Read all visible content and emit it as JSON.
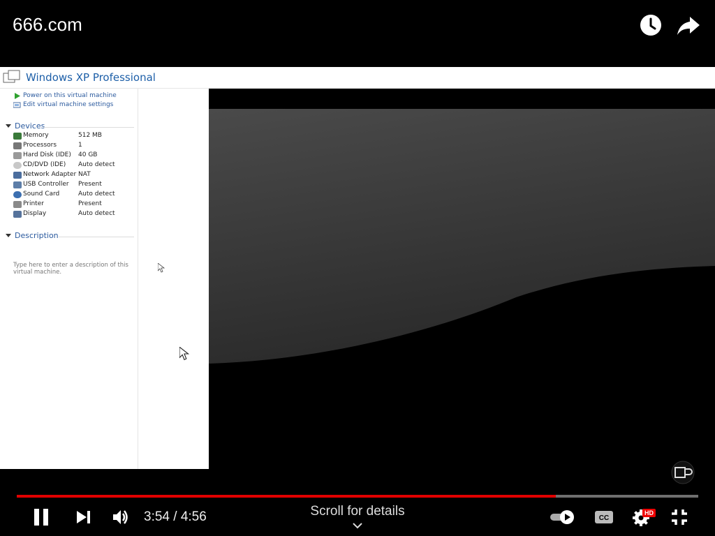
{
  "overlay": {
    "title": "666.com",
    "watch_later_icon": "clock-icon",
    "share_icon": "share-arrow-icon"
  },
  "vm": {
    "title": "Windows XP Professional",
    "actions": [
      {
        "label": "Power on this virtual machine",
        "icon": "play-icon"
      },
      {
        "label": "Edit virtual machine settings",
        "icon": "settings-icon"
      }
    ],
    "devices_heading": "Devices",
    "devices": [
      {
        "name": "Memory",
        "value": "512 MB",
        "icon": "memory-icon"
      },
      {
        "name": "Processors",
        "value": "1",
        "icon": "processor-icon"
      },
      {
        "name": "Hard Disk (IDE)",
        "value": "40 GB",
        "icon": "hard-disk-icon"
      },
      {
        "name": "CD/DVD (IDE)",
        "value": "Auto detect",
        "icon": "cd-icon"
      },
      {
        "name": "Network Adapter",
        "value": "NAT",
        "icon": "network-icon"
      },
      {
        "name": "USB Controller",
        "value": "Present",
        "icon": "usb-icon"
      },
      {
        "name": "Sound Card",
        "value": "Auto detect",
        "icon": "sound-icon"
      },
      {
        "name": "Printer",
        "value": "Present",
        "icon": "printer-icon"
      },
      {
        "name": "Display",
        "value": "Auto detect",
        "icon": "display-icon"
      }
    ],
    "description_heading": "Description",
    "description_placeholder": "Type here to enter a description of this virtual machine."
  },
  "player": {
    "current_time": "3:54",
    "separator": " / ",
    "duration": "4:56",
    "progress_fraction": 0.7905,
    "scroll_hint": "Scroll for details",
    "settings_badge": "HD",
    "colors": {
      "progress": "#e00000",
      "track": "#6f6f6f",
      "badge": "#e00000"
    }
  }
}
